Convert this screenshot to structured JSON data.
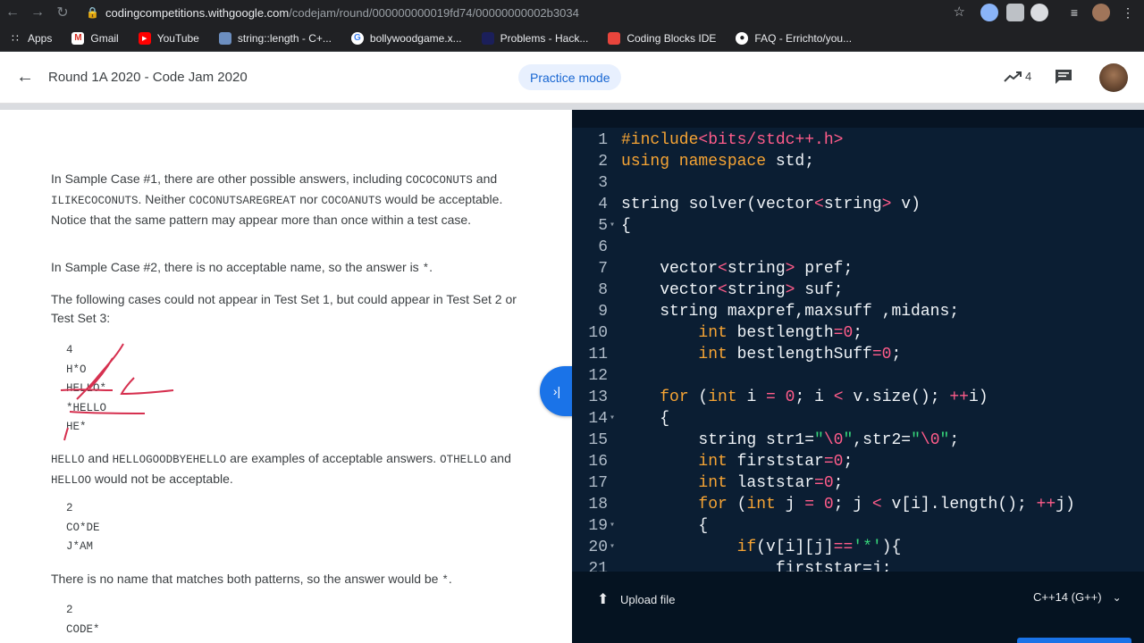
{
  "browser": {
    "url_domain": "codingcompetitions.withgoogle.com",
    "url_path": "/codejam/round/000000000019fd74/00000000002b3034",
    "bookmarks": [
      "Apps",
      "Gmail",
      "YouTube",
      "string::length - C+...",
      "bollywoodgame.x...",
      "Problems - Hack...",
      "Coding Blocks IDE",
      "FAQ - Errichto/you..."
    ]
  },
  "header": {
    "title": "Round 1A 2020 - Code Jam 2020",
    "practice_label": "Practice mode",
    "trend_count": "4"
  },
  "problem": {
    "p1": {
      "a": "In Sample Case #1, there are other possible answers, including ",
      "c1": "COCOCONUTS",
      "b": " and ",
      "c2": "ILIKECOCONUTS",
      "c": ". Neither ",
      "c3": "COCONUTSAREGREAT",
      "d": " nor ",
      "c4": "COCOANUTS",
      "e": " would be acceptable. Notice that the same pattern may appear more than once within a test case."
    },
    "p2": {
      "a": "In Sample Case #2, there is no acceptable name, so the answer is ",
      "c1": "*",
      "b": "."
    },
    "p3": "The following cases could not appear in Test Set 1, but could appear in Test Set 2 or Test Set 3:",
    "block1": [
      "4",
      "H*O",
      "HELLO*",
      "*HELLO",
      "HE*"
    ],
    "p4": {
      "c1": "HELLO",
      "a": " and ",
      "c2": "HELLOGOODBYEHELLO",
      "b": " are examples of acceptable answers. ",
      "c3": "OTHELLO",
      "c": " and ",
      "c4": "HELLOO",
      "d": " would not be acceptable."
    },
    "block2": [
      "2",
      "CO*DE",
      "J*AM"
    ],
    "p5": {
      "a": "There is no name that matches both patterns, so the answer would be ",
      "c1": "*",
      "b": "."
    },
    "block3": [
      "2",
      "CODE*"
    ]
  },
  "editor": {
    "line_numbers": [
      "1",
      "2",
      "3",
      "4",
      "5",
      "6",
      "7",
      "8",
      "9",
      "10",
      "11",
      "12",
      "13",
      "14",
      "15",
      "16",
      "17",
      "18",
      "19",
      "20",
      "21"
    ],
    "upload_label": "Upload file",
    "language": "C++14 (G++)"
  },
  "colors": {
    "accent": "#1a73e8",
    "editor_bg": "#0b1e33",
    "keyword": "#f6a434",
    "number": "#ff5c8a",
    "string": "#37d67a",
    "annotation": "#d6304f"
  }
}
